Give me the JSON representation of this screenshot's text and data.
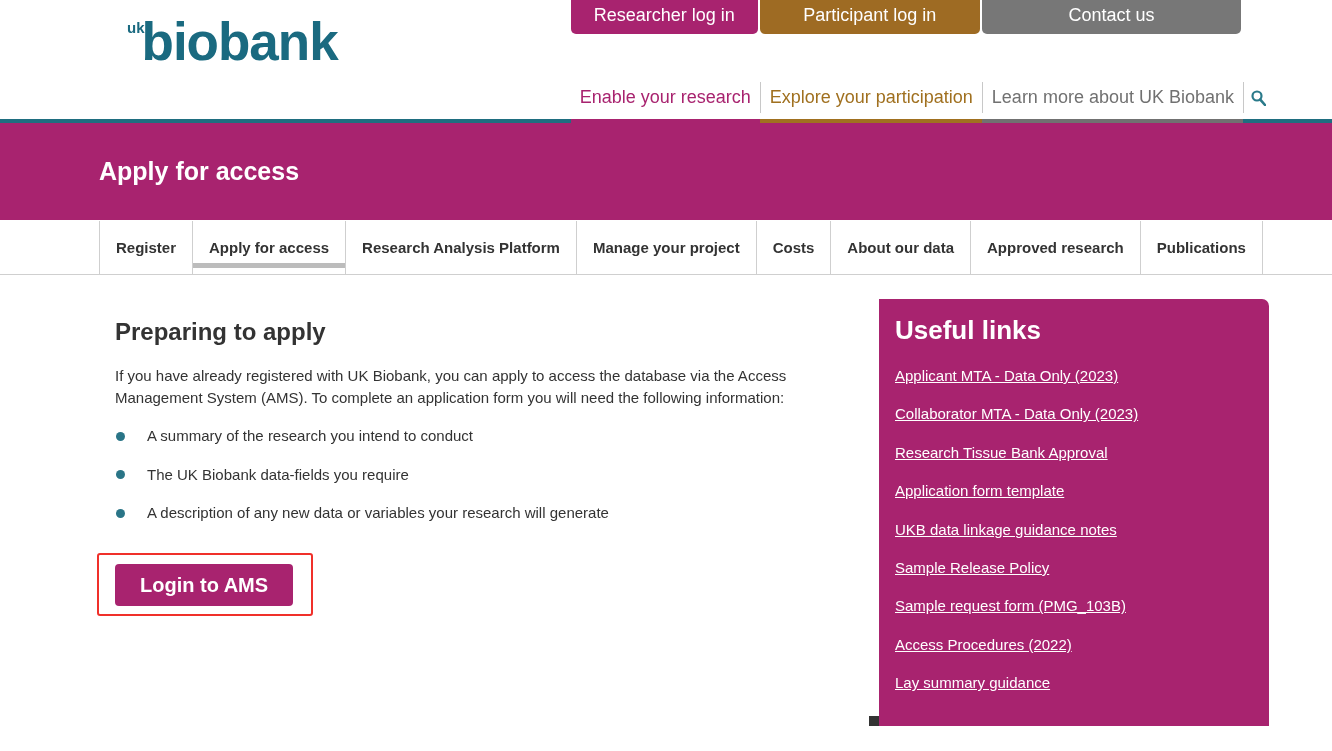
{
  "header": {
    "logo": {
      "prefix": "uk",
      "wordmark": "biobank"
    },
    "top_buttons": [
      {
        "label": "Researcher log in",
        "color": "#a8236f"
      },
      {
        "label": "Participant log in",
        "color": "#9e6b23"
      },
      {
        "label": "Contact us",
        "color": "#777777"
      }
    ],
    "nav": [
      {
        "label": "Enable your research",
        "color": "#a8236f"
      },
      {
        "label": "Explore your participation",
        "color": "#a0701f"
      },
      {
        "label": "Learn more about UK Biobank",
        "color": "#717171"
      }
    ]
  },
  "banner": {
    "title": "Apply for access"
  },
  "tabs": [
    {
      "label": "Register",
      "selected": false
    },
    {
      "label": "Apply for access",
      "selected": true
    },
    {
      "label": "Research Analysis Platform",
      "selected": false
    },
    {
      "label": "Manage your project",
      "selected": false
    },
    {
      "label": "Costs",
      "selected": false
    },
    {
      "label": "About our data",
      "selected": false
    },
    {
      "label": "Approved research",
      "selected": false
    },
    {
      "label": "Publications",
      "selected": false
    }
  ],
  "main": {
    "heading": "Preparing to apply",
    "paragraph": "If you have already registered with UK Biobank, you can apply to access the database via the Access Management System (AMS). To complete an application form you will need the following information:",
    "bullets": [
      "A summary of the research you intend to conduct",
      "The UK Biobank data-fields you require",
      "A description of any new data or variables your research will generate"
    ],
    "button": {
      "label": "Login to AMS",
      "highlighted": true
    }
  },
  "useful_links": {
    "title": "Useful links",
    "links": [
      "Applicant MTA - Data Only (2023)",
      "Collaborator MTA - Data Only (2023)",
      "Research Tissue Bank Approval",
      "Application form template",
      "UKB data linkage guidance notes",
      "Sample Release Policy",
      "Sample request form (PMG_103B)",
      "Access Procedures (2022)",
      "Lay summary guidance"
    ]
  }
}
